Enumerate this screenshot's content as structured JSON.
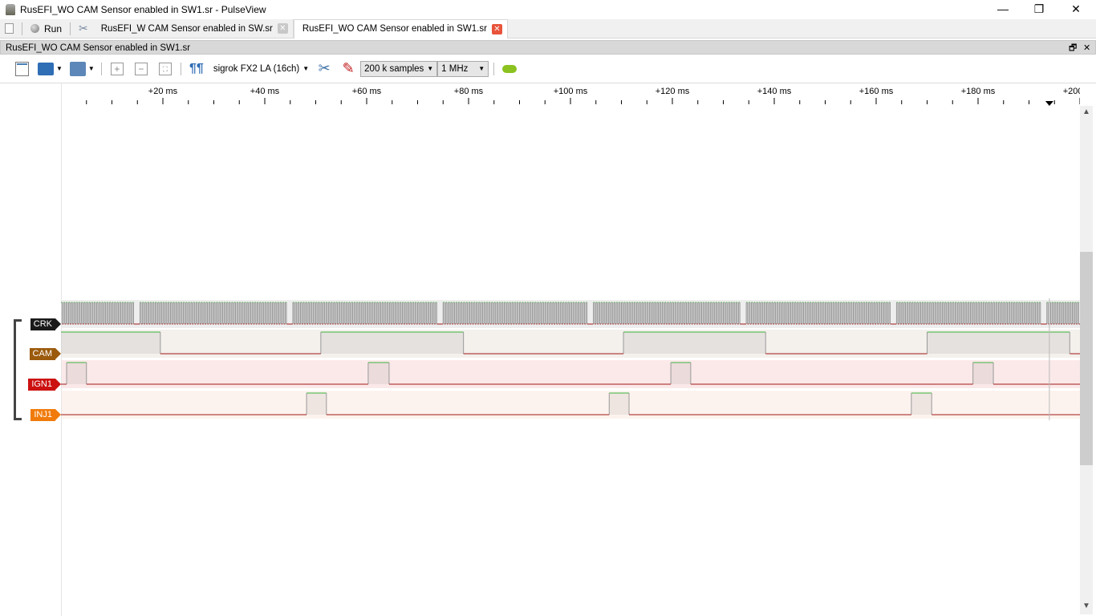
{
  "window": {
    "title": "RusEFI_WO CAM Sensor enabled in SW1.sr - PulseView",
    "minimize": "—",
    "restore": "❐",
    "close": "✕"
  },
  "tabbar": {
    "run_label": "Run",
    "tabs": [
      {
        "label": "RusEFI_W CAM Sensor enabled in SW.sr",
        "active": false
      },
      {
        "label": "RusEFI_WO CAM Sensor enabled in SW1.sr",
        "active": true
      }
    ]
  },
  "docbar": {
    "title": "RusEFI_WO CAM Sensor enabled in SW1.sr",
    "float": "🗗",
    "close": "✕"
  },
  "toolbar": {
    "device": "sigrok FX2 LA (16ch)",
    "samples": "200 k samples",
    "samplerate": "1 MHz"
  },
  "ruler": {
    "unit": "ms",
    "labels": [
      "+20 ms",
      "+40 ms",
      "+60 ms",
      "+80 ms",
      "+100 ms",
      "+120 ms",
      "+140 ms",
      "+160 ms",
      "+180 ms",
      "+200 ms"
    ],
    "cursor_ms": 194
  },
  "colors": {
    "high": "#3cb43c",
    "low": "#a01818",
    "edge": "#999999",
    "accent": "#e8533a"
  },
  "channels": [
    {
      "name": "CRK",
      "color": "#1a1a1a",
      "bg": "#eeeeee",
      "type": "crank",
      "gaps_ms": [
        14.2,
        44.3,
        73.9,
        103.5,
        133.1,
        162.7,
        192.3
      ],
      "tooth_period_ms": 0.5
    },
    {
      "name": "CAM",
      "color": "#9b5a0c",
      "bg": "#f4f0ec",
      "high_ms": [
        [
          0,
          19.5
        ],
        [
          51,
          79
        ],
        [
          110.4,
          138.3
        ],
        [
          170,
          198
        ]
      ]
    },
    {
      "name": "IGN1",
      "color": "#cc1111",
      "bg": "#fbe9e9",
      "high_ms": [
        [
          1.1,
          5
        ],
        [
          60.3,
          64.4
        ],
        [
          119.7,
          123.6
        ],
        [
          179,
          183
        ]
      ]
    },
    {
      "name": "INJ1",
      "color": "#f07b0a",
      "bg": "#fdf3ee",
      "high_ms": [
        [
          48.2,
          52.1
        ],
        [
          107.6,
          111.5
        ],
        [
          166.9,
          170.9
        ]
      ]
    }
  ]
}
